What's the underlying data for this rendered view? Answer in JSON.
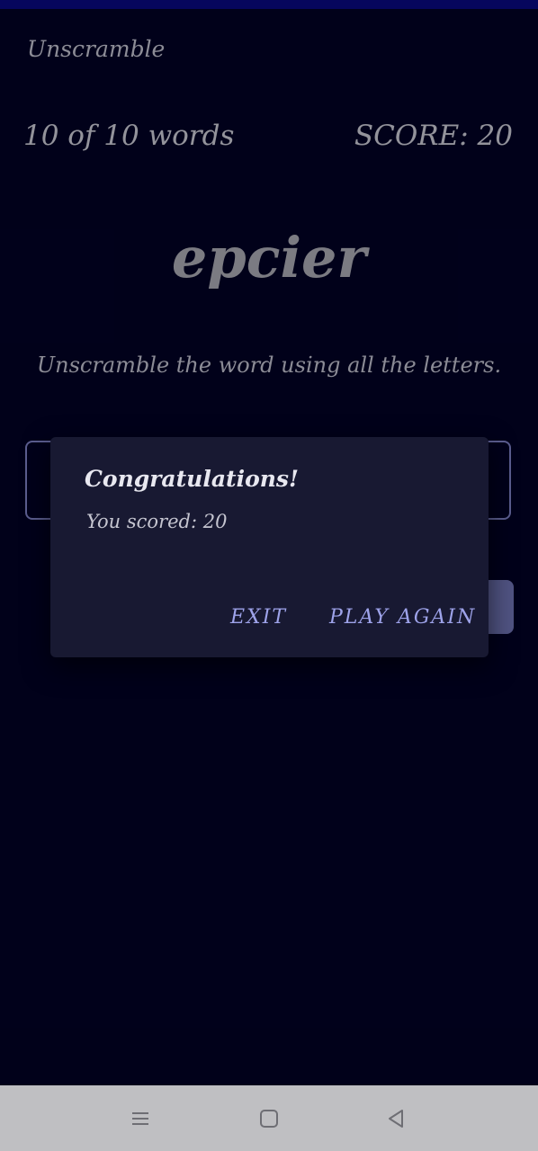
{
  "app": {
    "title": "Unscramble"
  },
  "game": {
    "progress": "10 of 10 words",
    "score": "SCORE: 20",
    "scrambled_word": "epcier",
    "instruction": "Unscramble the word using all the letters."
  },
  "input": {
    "hint": ""
  },
  "dialog": {
    "title": "Congratulations!",
    "message": "You scored: 20",
    "exit_label": "EXIT",
    "play_again_label": "PLAY AGAIN"
  },
  "nav": {
    "menu_icon": "menu-icon",
    "home_icon": "home-icon",
    "back_icon": "back-icon"
  },
  "colors": {
    "background": "#020224",
    "status_bar": "#0a0a8a",
    "dialog_bg": "#181932",
    "accent": "#9ea3ea"
  }
}
